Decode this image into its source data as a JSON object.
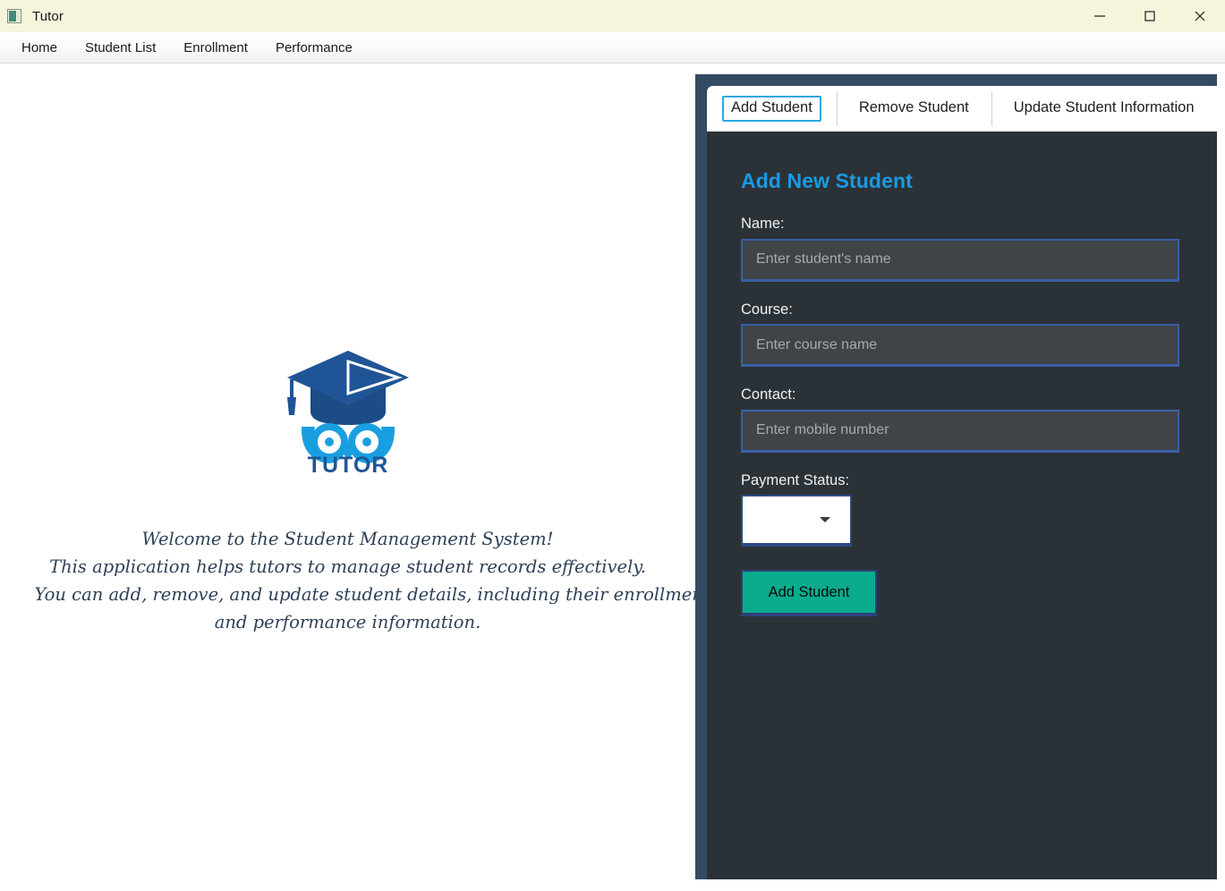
{
  "window": {
    "title": "Tutor",
    "icon": "app-icon",
    "controls": {
      "minimize": "minimize-icon",
      "maximize": "maximize-icon",
      "close": "close-icon"
    }
  },
  "menubar": {
    "items": [
      {
        "label": "Home"
      },
      {
        "label": "Student List"
      },
      {
        "label": "Enrollment"
      },
      {
        "label": "Performance"
      }
    ]
  },
  "home": {
    "logo": {
      "name": "tutor-owl-graduation-logo",
      "wordmark": "TUTOR",
      "cap_color": "#1f5596",
      "owl_color": "#199fe0",
      "text_color": "#1f5596"
    },
    "welcome": {
      "lines": [
        "Welcome to the Student Management System!",
        "This application helps tutors to manage student records effectively.",
        "You can add, remove, and update student details, including their enrollment",
        "and performance information."
      ]
    }
  },
  "panel": {
    "tabs": [
      {
        "label": "Add Student",
        "active": true
      },
      {
        "label": "Remove Student",
        "active": false
      },
      {
        "label": "Update Student Information",
        "active": false
      }
    ],
    "form": {
      "title": "Add New Student",
      "fields": [
        {
          "label": "Name:",
          "value": "",
          "placeholder": "Enter student's name"
        },
        {
          "label": "Course:",
          "value": "",
          "placeholder": "Enter course name"
        },
        {
          "label": "Contact:",
          "value": "",
          "placeholder": "Enter mobile number"
        }
      ],
      "payment_status": {
        "label": "Payment Status:",
        "selected": ""
      },
      "submit_label": "Add Student"
    }
  },
  "colors": {
    "titlebar_bg": "#f5f5dc",
    "frame": "#334a63",
    "panel_bg": "#2b3237",
    "accent_blue": "#1a9ae6",
    "accent_teal": "#0bab8e",
    "input_border": "#3a5fa8",
    "tab_focus": "#28a8e0"
  }
}
